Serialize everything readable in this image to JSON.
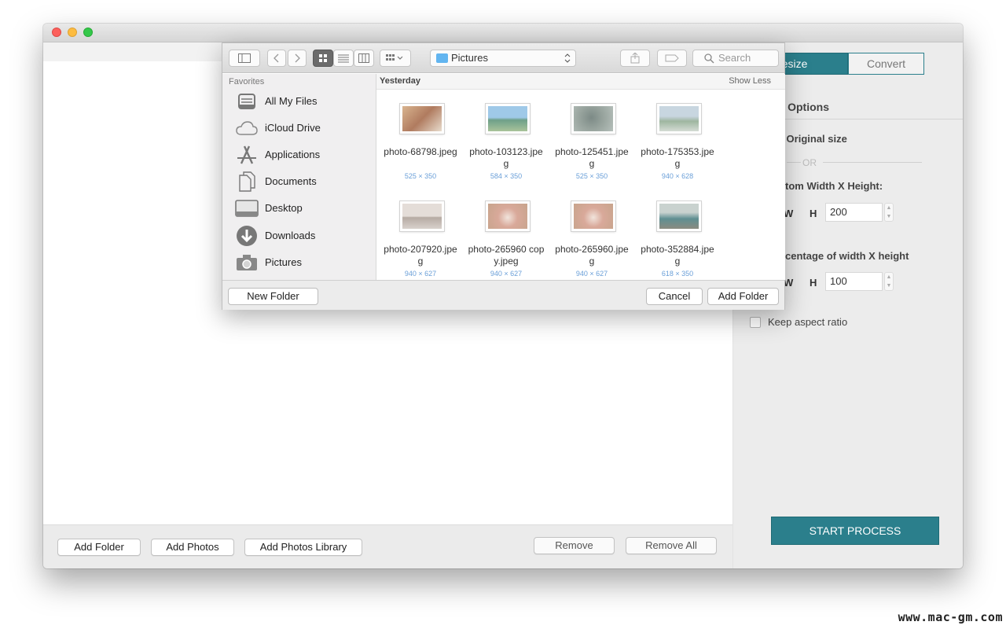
{
  "colors": {
    "accent": "#2b7f8c",
    "folder": "#62b5f0",
    "dimension_text": "#6a9fd8"
  },
  "main": {
    "bottom_buttons": {
      "add_folder": "Add Folder",
      "add_photos": "Add Photos",
      "add_photos_library": "Add Photos Library",
      "remove": "Remove",
      "remove_all": "Remove All"
    }
  },
  "panel": {
    "tabs": {
      "resize": "Resize",
      "convert": "Convert"
    },
    "options_title": "Options",
    "keep_original": "p Original size",
    "or": "OR",
    "custom_label": "tom Width X Height:",
    "w_label": "W",
    "h_label": "H",
    "custom_height": "200",
    "percentage_label": "centage of width X height",
    "percentage_height": "100",
    "keep_aspect": "Keep aspect ratio",
    "start_process": "START PROCESS"
  },
  "dialog": {
    "path": "Pictures",
    "search_placeholder": "Search",
    "favorites_heading": "Favorites",
    "favorites": [
      {
        "label": "All My Files",
        "icon": "all-files-icon"
      },
      {
        "label": "iCloud Drive",
        "icon": "cloud-icon"
      },
      {
        "label": "Applications",
        "icon": "applications-icon"
      },
      {
        "label": "Documents",
        "icon": "documents-icon"
      },
      {
        "label": "Desktop",
        "icon": "desktop-icon"
      },
      {
        "label": "Downloads",
        "icon": "downloads-icon"
      },
      {
        "label": "Pictures",
        "icon": "camera-icon"
      }
    ],
    "group_title": "Yesterday",
    "show_less": "Show Less",
    "files": [
      {
        "name": "photo-68798.jpeg",
        "dims": "525 × 350"
      },
      {
        "name": "photo-103123.jpeg",
        "dims": "584 × 350"
      },
      {
        "name": "photo-125451.jpeg",
        "dims": "525 × 350"
      },
      {
        "name": "photo-175353.jpeg",
        "dims": "940 × 628"
      },
      {
        "name": "photo-207920.jpeg",
        "dims": "940 × 627"
      },
      {
        "name": "photo-265960 copy.jpeg",
        "dims": "940 × 627"
      },
      {
        "name": "photo-265960.jpeg",
        "dims": "940 × 627"
      },
      {
        "name": "photo-352884.jpeg",
        "dims": "618 × 350"
      }
    ],
    "new_folder": "New Folder",
    "cancel": "Cancel",
    "add_folder": "Add Folder"
  },
  "watermark": "www.mac-gm.com"
}
